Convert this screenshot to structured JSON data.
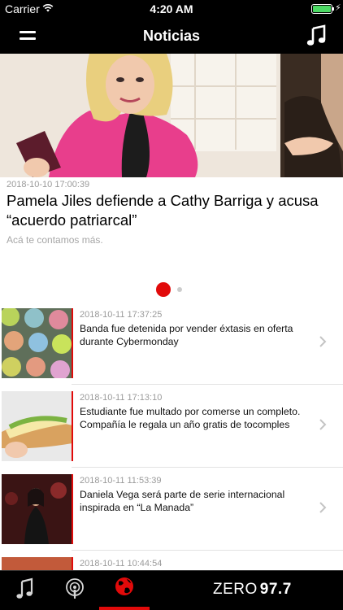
{
  "status": {
    "carrier": "Carrier",
    "time": "4:20 AM",
    "battery_level": 1.0
  },
  "nav": {
    "title": "Noticias",
    "menu_icon": "menu-icon",
    "music_icon": "music-note-icon"
  },
  "hero": {
    "date": "2018-10-10 17:00:39",
    "title": "Pamela Jiles defiende a Cathy Barriga y acusa “acuerdo patriarcal”",
    "subtitle": "Acá te contamos más.",
    "pager_total": 2,
    "pager_active": 1
  },
  "news": [
    {
      "date": "2018-10-11 17:37:25",
      "headline": "Banda fue detenida por vender éxtasis en oferta durante Cybermonday"
    },
    {
      "date": "2018-10-11 17:13:10",
      "headline": "Estudiante fue multado por comerse un completo. Compañía le regala un año gratis de tocomples"
    },
    {
      "date": "2018-10-11 11:53:39",
      "headline": "Daniela Vega será parte de serie internacional inspirada en “La Manada”"
    },
    {
      "date": "2018-10-11 10:44:54",
      "headline": ""
    }
  ],
  "tabbar": {
    "tabs": [
      "music-icon",
      "podcast-icon",
      "globe-icon"
    ],
    "active_tab": "globe-icon",
    "brand_zero": "ZERO",
    "brand_freq": "97.7"
  },
  "colors": {
    "accent": "#e10a0a",
    "bar_background": "#000000",
    "battery": "#4cd964"
  }
}
